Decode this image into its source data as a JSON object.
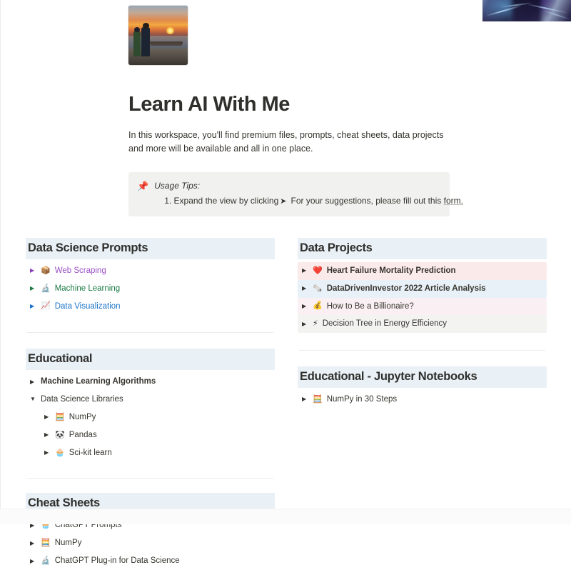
{
  "page": {
    "title": "Learn AI With Me",
    "description": "In this workspace, you'll find premium files, prompts, cheat sheets, data projects and more will be available and all in one place.",
    "avatar_alt": "sunset-photo-two-people",
    "cover_alt": "abstract-blue-cover-fragment"
  },
  "callout": {
    "icon": "📌",
    "title": "Usage Tips:",
    "line_prefix": "1. Expand the view by clicking",
    "arrow": "➤",
    "line_suffix": "For your suggestions, please fill out this",
    "link_label": "form."
  },
  "sections": {
    "data_science_prompts": {
      "header": "Data Science Prompts",
      "rows": [
        {
          "caret": "▶",
          "icon": "📦",
          "label": "Web Scraping",
          "color": "#9b51c4",
          "caret_color": "#8b3fb8",
          "bold": false,
          "bg": "transparent"
        },
        {
          "caret": "▶",
          "icon": "🔬",
          "label": "Machine Learning",
          "color": "#1b7a44",
          "caret_color": "#1f7a46",
          "bold": false,
          "bg": "transparent"
        },
        {
          "caret": "▶",
          "icon": "📈",
          "label": "Data Visualization",
          "color": "#1a73c7",
          "caret_color": "#1a73c7",
          "bold": false,
          "bg": "transparent"
        }
      ]
    },
    "educational": {
      "header": "Educational",
      "rows": [
        {
          "caret": "▶",
          "icon": "",
          "label": "Machine Learning Algorithms",
          "color": "#37352f",
          "caret_color": "#37352f",
          "bold": true,
          "bg": "transparent",
          "indent": 0
        },
        {
          "caret": "▼",
          "icon": "",
          "label": "Data Science Libraries",
          "color": "#37352f",
          "caret_color": "#37352f",
          "bold": false,
          "bg": "transparent",
          "indent": 0
        },
        {
          "caret": "▶",
          "icon": "🧮",
          "label": "NumPy",
          "color": "#37352f",
          "caret_color": "#37352f",
          "bold": false,
          "bg": "transparent",
          "indent": 1
        },
        {
          "caret": "▶",
          "icon": "🐼",
          "label": "Pandas",
          "color": "#37352f",
          "caret_color": "#37352f",
          "bold": false,
          "bg": "transparent",
          "indent": 1
        },
        {
          "caret": "▶",
          "icon": "🧁",
          "label": "Sci-kit learn",
          "color": "#37352f",
          "caret_color": "#37352f",
          "bold": false,
          "bg": "transparent",
          "indent": 1
        }
      ]
    },
    "cheat_sheets": {
      "header": "Cheat Sheets",
      "rows": [
        {
          "caret": "▶",
          "icon": "🧁",
          "label": "ChatGPT Prompts",
          "color": "#37352f",
          "caret_color": "#37352f",
          "bold": false,
          "bg": "transparent"
        },
        {
          "caret": "▶",
          "icon": "🧮",
          "label": "NumPy",
          "color": "#37352f",
          "caret_color": "#37352f",
          "bold": false,
          "bg": "transparent"
        },
        {
          "caret": "▶",
          "icon": "🔬",
          "label": "ChatGPT Plug-in for Data Science",
          "color": "#37352f",
          "caret_color": "#37352f",
          "bold": false,
          "bg": "transparent"
        }
      ]
    },
    "data_projects": {
      "header": "Data Projects",
      "rows": [
        {
          "caret": "▶",
          "icon": "❤️",
          "label": "Heart Failure Mortality Prediction",
          "color": "#37352f",
          "caret_color": "#37352f",
          "bold": true,
          "bg": "#fbeaea"
        },
        {
          "caret": "▶",
          "icon": "🗞️",
          "label": "DataDrivenInvestor 2022 Article Analysis",
          "color": "#37352f",
          "caret_color": "#37352f",
          "bold": true,
          "bg": "#e9f1f8"
        },
        {
          "caret": "▶",
          "icon": "💰",
          "label": "How to Be a Billionaire?",
          "color": "#37352f",
          "caret_color": "#37352f",
          "bold": false,
          "bg": "#faf0f4"
        },
        {
          "caret": "▶",
          "icon": "⚡",
          "label": "Decision Tree in Energy Efficiency",
          "color": "#37352f",
          "caret_color": "#37352f",
          "bold": false,
          "bg": "#f3f3f2"
        }
      ]
    },
    "educational_jupyter": {
      "header": "Educational - Jupyter Notebooks",
      "rows": [
        {
          "caret": "▶",
          "icon": "🧮",
          "label": "NumPy in 30 Steps",
          "color": "#37352f",
          "caret_color": "#37352f",
          "bold": false,
          "bg": "transparent"
        }
      ]
    }
  },
  "colors": {
    "section_header_bg": "#e9f0f6",
    "callout_bg": "#f1f1ef",
    "divider": "#ececeb",
    "text": "#37352f"
  }
}
